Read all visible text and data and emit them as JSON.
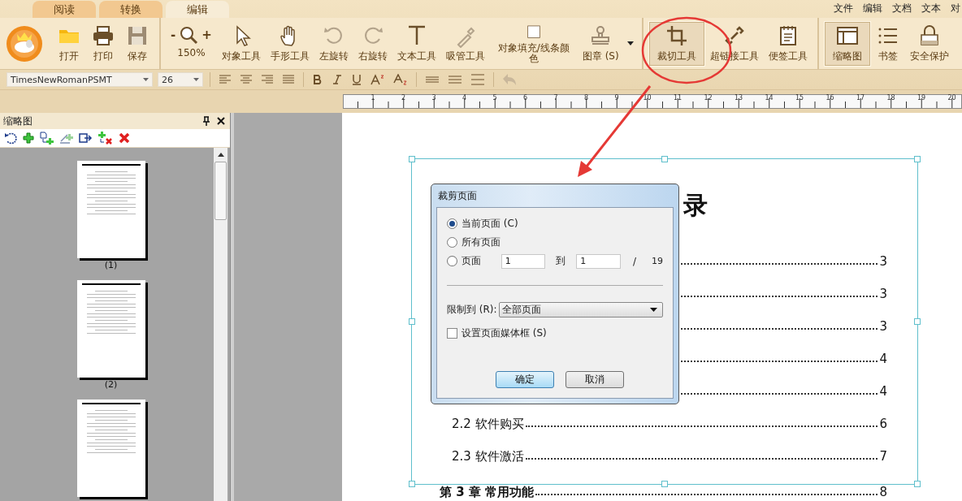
{
  "app_tabs": [
    {
      "label": "阅读",
      "selected": false
    },
    {
      "label": "转换",
      "selected": false
    },
    {
      "label": "编辑",
      "selected": true
    }
  ],
  "menu": [
    "文件",
    "编辑",
    "文档",
    "文本",
    "对"
  ],
  "ribbon": [
    {
      "items": [
        {
          "kind": "button",
          "label": "打开",
          "selected": false
        },
        {
          "kind": "button",
          "label": "打印",
          "selected": false
        },
        {
          "kind": "button",
          "label": "保存",
          "selected": false
        }
      ]
    },
    {
      "items": [
        {
          "kind": "zoom",
          "minus": "-",
          "plus": "+",
          "label": "150%"
        },
        {
          "kind": "button",
          "label": "对象工具",
          "selected": false
        },
        {
          "kind": "button",
          "label": "手形工具",
          "selected": false
        },
        {
          "kind": "button",
          "label": "左旋转",
          "selected": false
        },
        {
          "kind": "button",
          "label": "右旋转",
          "selected": false
        },
        {
          "kind": "button",
          "label": "文本工具",
          "selected": false
        },
        {
          "kind": "button",
          "label": "吸管工具",
          "selected": false
        },
        {
          "kind": "button",
          "label": "对象填充/线条颜色",
          "selected": false
        },
        {
          "kind": "button",
          "label": "图章 (S)",
          "selected": false
        },
        {
          "kind": "menu-arrow"
        }
      ]
    },
    {
      "items": [
        {
          "kind": "button",
          "label": "裁切工具",
          "selected": true
        },
        {
          "kind": "button",
          "label": "超链接工具",
          "selected": false
        },
        {
          "kind": "button",
          "label": "便签工具",
          "selected": false
        }
      ]
    },
    {
      "items": [
        {
          "kind": "button",
          "label": "缩略图",
          "selected": true
        },
        {
          "kind": "button",
          "label": "书签",
          "selected": false
        },
        {
          "kind": "button",
          "label": "安全保护",
          "selected": false
        }
      ]
    }
  ],
  "format_bar": {
    "font": "TimesNewRomanPSMT",
    "size": "26"
  },
  "ruler": [
    "1",
    "2",
    "3",
    "4",
    "5",
    "6",
    "7",
    "8",
    "9",
    "10",
    "11",
    "12",
    "13",
    "14",
    "15",
    "16",
    "17",
    "18",
    "19",
    "20"
  ],
  "thumbnail_panel": {
    "title": "缩略图",
    "pages": [
      {
        "label": "(1)",
        "selected": false
      },
      {
        "label": "(2)",
        "selected": false
      },
      {
        "selected": false
      }
    ]
  },
  "document": {
    "title": "录",
    "entries": [
      {
        "kind": "section",
        "page": "3"
      },
      {
        "kind": "section",
        "page": "3"
      },
      {
        "kind": "section",
        "page": "3"
      },
      {
        "kind": "section",
        "page": "4"
      },
      {
        "kind": "section",
        "page": "4"
      },
      {
        "kind": "section",
        "text": "2.2 软件购买",
        "page": "6"
      },
      {
        "kind": "section",
        "text": "2.3 软件激活",
        "page": "7"
      },
      {
        "kind": "chapter",
        "text": "第 3 章  常用功能",
        "page": "8"
      }
    ]
  },
  "dialog": {
    "title": "裁剪页面",
    "scope_options": [
      {
        "label": "当前页面 (C)",
        "selected": true
      },
      {
        "label": "所有页面",
        "selected": false
      },
      {
        "label": "页面",
        "selected": false
      }
    ],
    "from": "1",
    "to_label": "到",
    "to": "1",
    "slash": "/",
    "total": "19",
    "limit_label": "限制到 (R):",
    "limit_value": "全部页面",
    "media_box": {
      "label": "设置页面媒体框 (S)",
      "checked": false
    },
    "buttons": [
      {
        "label": "确定",
        "default": true
      },
      {
        "label": "取消",
        "default": false
      }
    ]
  },
  "annotations": {
    "circle": {
      "color": "#e53935"
    },
    "arrow": {
      "color": "#e53935"
    }
  }
}
